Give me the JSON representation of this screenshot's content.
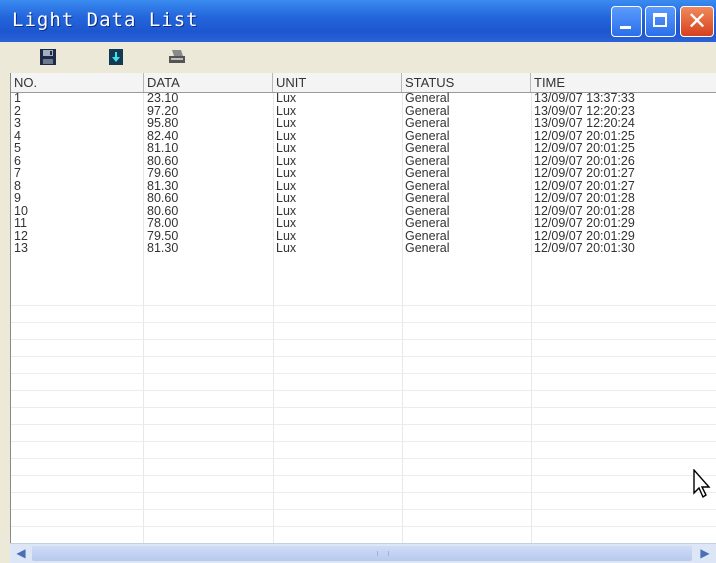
{
  "window": {
    "title": "Light Data List"
  },
  "toolbar": {
    "items": [
      {
        "icon": "save-icon"
      },
      {
        "icon": "download-icon"
      },
      {
        "icon": "print-icon"
      }
    ]
  },
  "table": {
    "columns": [
      "NO.",
      "DATA",
      "UNIT",
      "STATUS",
      "TIME"
    ],
    "rows": [
      [
        "1",
        "23.10",
        "Lux",
        "General",
        "13/09/07 13:37:33"
      ],
      [
        "2",
        "97.20",
        "Lux",
        "General",
        "13/09/07 12:20:23"
      ],
      [
        "3",
        "95.80",
        "Lux",
        "General",
        "13/09/07 12:20:24"
      ],
      [
        "4",
        "82.40",
        "Lux",
        "General",
        "12/09/07 20:01:25"
      ],
      [
        "5",
        "81.10",
        "Lux",
        "General",
        "12/09/07 20:01:25"
      ],
      [
        "6",
        "80.60",
        "Lux",
        "General",
        "12/09/07 20:01:26"
      ],
      [
        "7",
        "79.60",
        "Lux",
        "General",
        "12/09/07 20:01:27"
      ],
      [
        "8",
        "81.30",
        "Lux",
        "General",
        "12/09/07 20:01:27"
      ],
      [
        "9",
        "80.60",
        "Lux",
        "General",
        "12/09/07 20:01:28"
      ],
      [
        "10",
        "80.60",
        "Lux",
        "General",
        "12/09/07 20:01:28"
      ],
      [
        "11",
        "78.00",
        "Lux",
        "General",
        "12/09/07 20:01:29"
      ],
      [
        "12",
        "79.50",
        "Lux",
        "General",
        "12/09/07 20:01:29"
      ],
      [
        "13",
        "81.30",
        "Lux",
        "General",
        "12/09/07 20:01:30"
      ]
    ]
  },
  "colors": {
    "titlebar": "#2466dc",
    "close_button": "#d6401f",
    "toolbar": "#ece9d8"
  }
}
